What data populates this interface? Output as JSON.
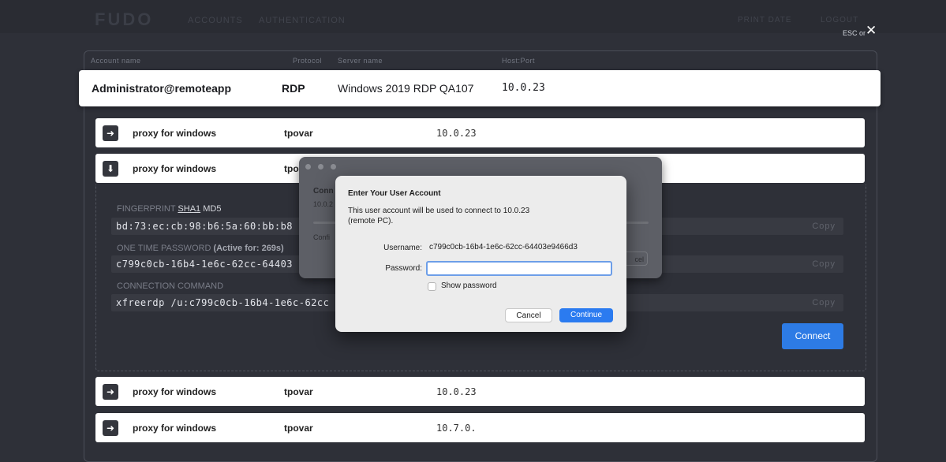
{
  "topbar": {
    "logo": "FUDO",
    "nav": [
      "ACCOUNTS",
      "AUTHENTICATION"
    ],
    "right_items": [
      "PRINT DATE",
      "LOGOUT"
    ],
    "esc_label": "ESC or",
    "close_glyph": "✕"
  },
  "table_headers": {
    "account_name": "Account name",
    "protocol": "Protocol",
    "server_name": "Server name",
    "host_port": "Host:Port"
  },
  "account": {
    "name": "Administrator@remoteapp",
    "protocol": "RDP",
    "server": "Windows 2019 RDP QA107",
    "host": "10.0.23"
  },
  "rows": [
    {
      "name": "proxy for windows",
      "user": "tpovar",
      "host": "10.0.23",
      "icon": "arrow-right-icon",
      "glyph": "➜"
    },
    {
      "name": "proxy for windows",
      "user": "tpo",
      "host": "",
      "icon": "arrow-down-icon",
      "glyph": "⬇"
    },
    {
      "name": "proxy for windows",
      "user": "tpovar",
      "host": "10.0.23",
      "icon": "arrow-right-icon",
      "glyph": "➜"
    },
    {
      "name": "proxy for windows",
      "user": "tpovar",
      "host": "10.7.0.",
      "icon": "arrow-right-icon",
      "glyph": "➜"
    }
  ],
  "details": {
    "fingerprint_label": "FINGERPRINT",
    "sha1": "SHA1",
    "md5": "MD5",
    "fingerprint_value": "bd:73:ec:cb:98:b6:5a:60:bb:b8",
    "otp_label": "ONE TIME PASSWORD",
    "otp_active": "(Active for: 269s)",
    "otp_value": "c799c0cb-16b4-1e6c-62cc-64403",
    "cmd_label": "CONNECTION COMMAND",
    "cmd_value": "xfreerdp /u:c799c0cb-16b4-1e6c-62cc",
    "copy": "Copy",
    "connect": "Connect"
  },
  "bg_window": {
    "title_fragment": "Conn",
    "host_fragment": "10.0.2",
    "config_fragment": "Confi",
    "button_fragment": "cel"
  },
  "dialog": {
    "title": "Enter Your User Account",
    "message_line1": "This user account will be used to connect to 10.0.23",
    "message_line2": "(remote PC).",
    "username_label": "Username:",
    "username_value": "c799c0cb-16b4-1e6c-62cc-64403e9466d3",
    "password_label": "Password:",
    "password_value": "",
    "show_password": "Show password",
    "cancel": "Cancel",
    "continue": "Continue"
  }
}
